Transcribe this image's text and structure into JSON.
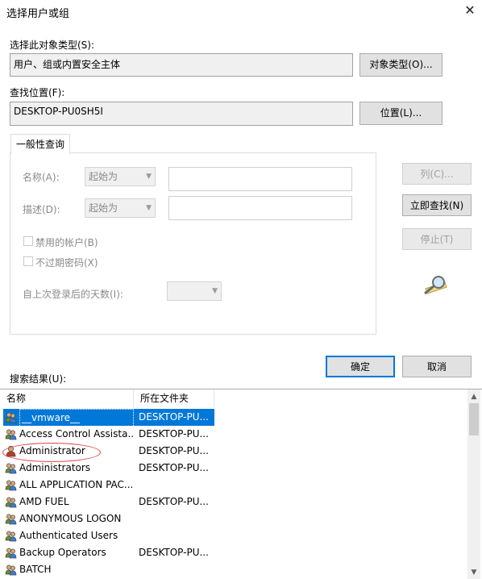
{
  "dialog": {
    "title": "选择用户或组",
    "close_glyph": "✕"
  },
  "object_types": {
    "label": "选择此对象类型(S):",
    "value": "用户、组或内置安全主体",
    "button": "对象类型(O)..."
  },
  "location": {
    "label": "查找位置(F):",
    "value": "DESKTOP-PU0SH5I",
    "button": "位置(L)..."
  },
  "tab": {
    "label": "一般性查询"
  },
  "query": {
    "name_label": "名称(A):",
    "name_mode": "起始为",
    "desc_label": "描述(D):",
    "desc_mode": "起始为",
    "disabled_accounts": "禁用的帐户(B)",
    "no_expire": "不过期密码(X)",
    "days_label": "自上次登录后的天数(I):"
  },
  "buttons": {
    "columns": "列(C)...",
    "find_now": "立即查找(N)",
    "stop": "停止(T)",
    "ok": "确定",
    "cancel": "取消"
  },
  "results": {
    "label": "搜索结果(U):",
    "headers": [
      "名称",
      "所在文件夹"
    ],
    "rows": [
      {
        "name": "__vmware__",
        "folder": "DESKTOP-PU..."
      },
      {
        "name": "Access Control Assista...",
        "folder": "DESKTOP-PU..."
      },
      {
        "name": "Administrator",
        "folder": "DESKTOP-PU..."
      },
      {
        "name": "Administrators",
        "folder": "DESKTOP-PU..."
      },
      {
        "name": "ALL APPLICATION PAC...",
        "folder": ""
      },
      {
        "name": "AMD FUEL",
        "folder": "DESKTOP-PU..."
      },
      {
        "name": "ANONYMOUS LOGON",
        "folder": ""
      },
      {
        "name": "Authenticated Users",
        "folder": ""
      },
      {
        "name": "Backup Operators",
        "folder": "DESKTOP-PU..."
      },
      {
        "name": "BATCH",
        "folder": ""
      }
    ]
  },
  "colors": {
    "accent": "#0078d7",
    "annotation": "#e04545"
  },
  "icons": {
    "find": "magnifier-icon",
    "group": "group-icon",
    "user": "user-icon"
  }
}
